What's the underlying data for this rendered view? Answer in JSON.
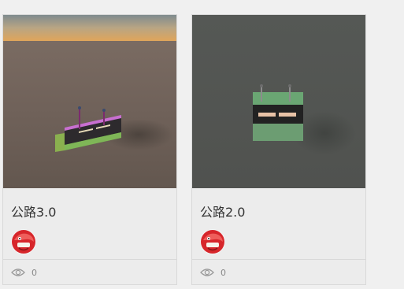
{
  "cards": [
    {
      "title": "公路3.0",
      "views": "0",
      "thumbnail": "road-model-on-ground-at-sunset"
    },
    {
      "title": "公路2.0",
      "views": "0",
      "thumbnail": "road-model-on-dark-ground"
    }
  ],
  "icons": {
    "views": "eye-icon",
    "avatar": "red-dragon-avatar"
  },
  "colors": {
    "card_background": "#ececec",
    "card_border": "#d9d9d9",
    "title_text": "#333333",
    "stat_text": "#888888"
  }
}
